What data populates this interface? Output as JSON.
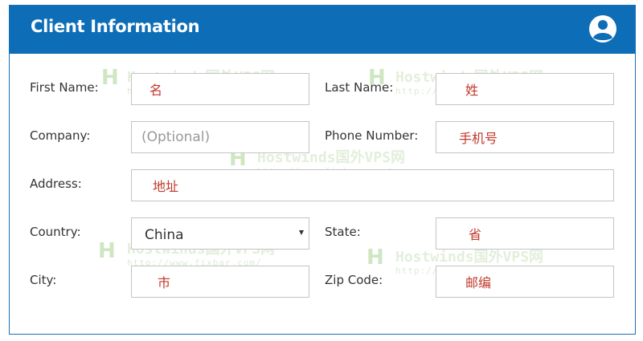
{
  "header": {
    "title": "Client Information",
    "icon": "user-circle-icon"
  },
  "form": {
    "first_name": {
      "label": "First Name:",
      "value": "名"
    },
    "last_name": {
      "label": "Last Name:",
      "value": "姓"
    },
    "company": {
      "label": "Company:",
      "placeholder": "(Optional)"
    },
    "phone": {
      "label": "Phone Number:",
      "value": "手机号"
    },
    "address": {
      "label": "Address:",
      "value": "地址"
    },
    "country": {
      "label": "Country:",
      "selected": "China"
    },
    "state": {
      "label": "State:",
      "value": "省"
    },
    "city": {
      "label": "City:",
      "value": "市"
    },
    "zip": {
      "label": "Zip Code:",
      "value": "邮编"
    }
  },
  "watermark": {
    "text": "Hostwinds国外VPS网",
    "url": "http://www.fixbar.com/"
  },
  "colors": {
    "header_bg": "#0d6eb7",
    "field_value": "#c0392b",
    "border": "#c4c4c4"
  }
}
